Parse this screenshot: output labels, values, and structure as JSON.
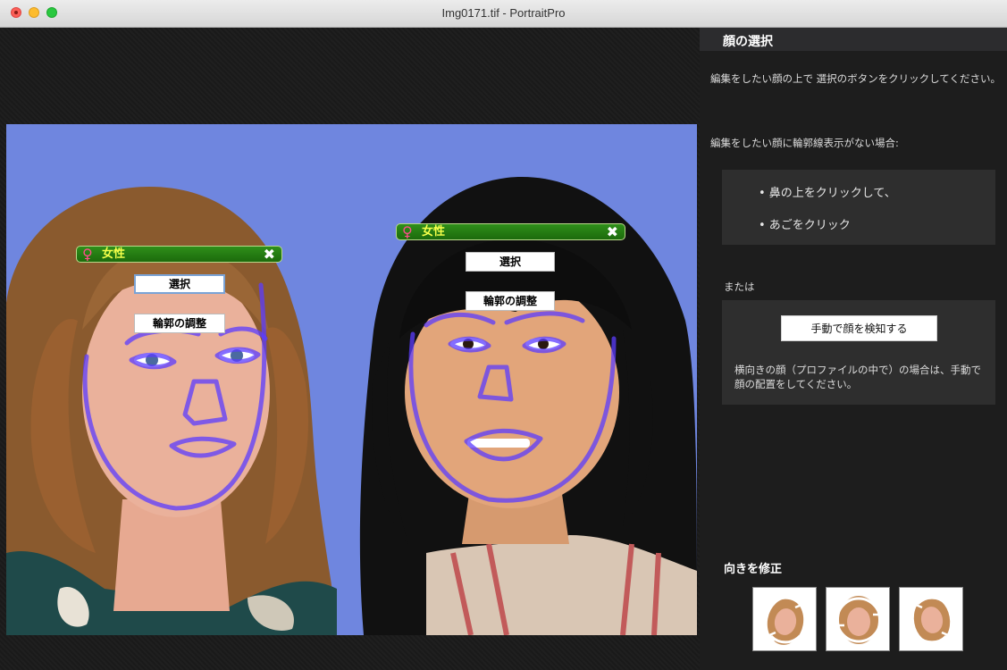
{
  "window": {
    "title": "Img0171.tif - PortraitPro"
  },
  "faces": [
    {
      "gender_label": "女性",
      "select_label": "選択",
      "contour_label": "輪郭の調整"
    },
    {
      "gender_label": "女性",
      "select_label": "選択",
      "contour_label": "輪郭の調整"
    }
  ],
  "panel": {
    "header": "顔の選択",
    "instruction": "編集をしたい顔の上で 選択のボタンをクリックしてください。",
    "no_outline_text": "編集をしたい顔に輪郭線表示がない場合:",
    "bullets": [
      "• 鼻の上をクリックして、",
      "• あごをクリック"
    ],
    "or_text": "または",
    "manual_button": "手動で顔を検知する",
    "profile_note": "横向きの顔（プロファイルの中で）の場合は、手動で顔の配置をしてください。",
    "rotate_title": "向きを修正"
  },
  "colors": {
    "accent_outline": "#5b3cff",
    "label_green": "#2f8f1a",
    "gender_icon": "#ff4d8d"
  }
}
